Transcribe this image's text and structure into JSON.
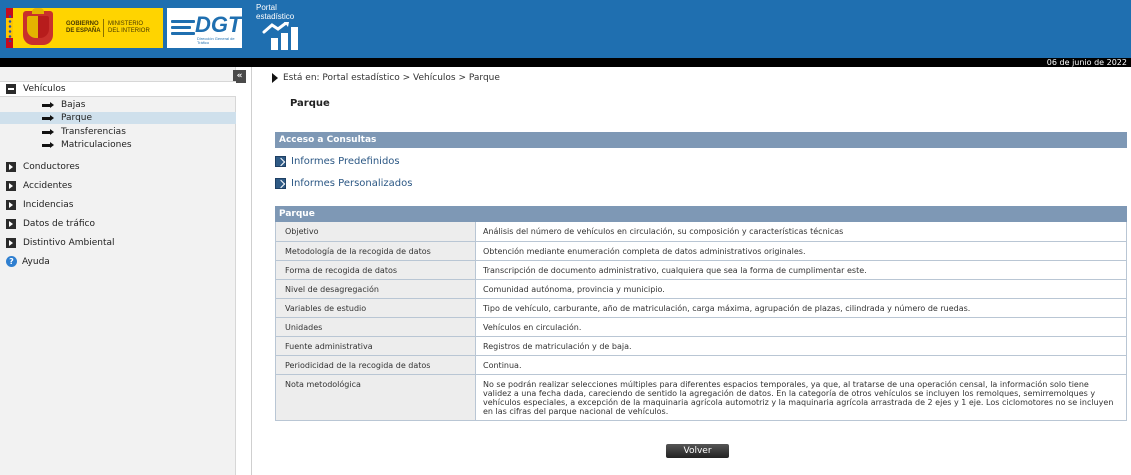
{
  "header": {
    "gov_line_1": "GOBIERNO",
    "gov_line_2": "DE ESPAÑA",
    "ministry_line_1": "MINISTERIO",
    "ministry_line_2": "DEL INTERIOR",
    "dgt_word": "DGT",
    "dgt_sub": "Dirección General de Tráfico",
    "portal_label": "Portal estadístico",
    "date": "06 de junio de 2022",
    "colors": {
      "bar": "#1f6fb0",
      "gov_logo": "#ffd400"
    }
  },
  "sidebar": {
    "sections": [
      {
        "label": "Vehículos",
        "icon": "minus-box-icon"
      },
      {
        "label": "Conductores",
        "icon": "expand-box-icon"
      },
      {
        "label": "Accidentes",
        "icon": "expand-box-icon"
      },
      {
        "label": "Incidencias",
        "icon": "expand-box-icon"
      },
      {
        "label": "Datos de tráfico",
        "icon": "expand-box-icon"
      },
      {
        "label": "Distintivo Ambiental",
        "icon": "expand-box-icon"
      }
    ],
    "vehiculos_items": [
      {
        "label": "Bajas"
      },
      {
        "label": "Parque",
        "selected": true
      },
      {
        "label": "Transferencias"
      },
      {
        "label": "Matriculaciones"
      }
    ],
    "help_label": "Ayuda",
    "collapse_glyph": "«"
  },
  "main": {
    "breadcrumb": "Está en: Portal estadístico > Vehículos > Parque",
    "title": "Parque",
    "acceso_header": "Acceso a Consultas",
    "links": [
      {
        "label": "Informes Predefinidos"
      },
      {
        "label": "Informes Personalizados"
      }
    ],
    "parque_header": "Parque",
    "rows": [
      {
        "key": "Objetivo",
        "value": "Análisis del número de vehículos en circulación, su composición y características técnicas"
      },
      {
        "key": "Metodología de la recogida de datos",
        "value": "Obtención mediante enumeración completa de datos administrativos originales."
      },
      {
        "key": "Forma de recogida de datos",
        "value": "Transcripción de documento administrativo, cualquiera que sea la forma de cumplimentar este."
      },
      {
        "key": "Nivel de desagregación",
        "value": "Comunidad autónoma, provincia y municipio."
      },
      {
        "key": "Variables de estudio",
        "value": "Tipo de vehículo, carburante, año de matriculación, carga máxima, agrupación de plazas, cilindrada y número de ruedas."
      },
      {
        "key": "Unidades",
        "value": "Vehículos en circulación."
      },
      {
        "key": "Fuente administrativa",
        "value": "Registros de matriculación y de baja."
      },
      {
        "key": "Periodicidad de la recogida de datos",
        "value": "Continua."
      },
      {
        "key": "Nota metodológica",
        "value": "No se podrán realizar selecciones múltiples para diferentes espacios temporales, ya que, al tratarse de una operación censal, la información solo tiene validez a una fecha dada, careciendo de sentido la agregación de datos. En la categoría de otros vehículos se incluyen los remolques, semirremolques y vehículos especiales, a excepción de la maquinaria agrícola automotriz y la maquinaria agrícola arrastrada de 2 ejes y 1 eje. Los ciclomotores no se incluyen en las cifras del parque nacional de vehículos."
      }
    ],
    "back_button": "Volver",
    "colors": {
      "section_header": "#7e98b5",
      "link": "#2b5784"
    }
  }
}
